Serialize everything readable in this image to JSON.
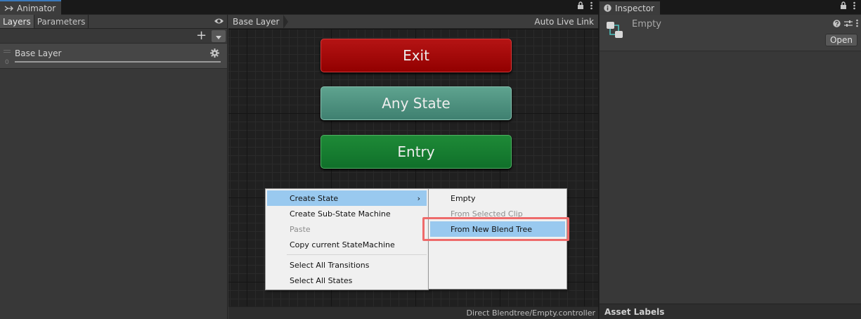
{
  "animator": {
    "tab_title": "Animator",
    "left_tabs": [
      "Layers",
      "Parameters"
    ],
    "add_label": "+",
    "layer": {
      "name": "Base Layer",
      "index": "0",
      "weight": 1
    },
    "breadcrumb": "Base Layer",
    "auto_live_link": "Auto Live Link",
    "states": {
      "exit": "Exit",
      "any": "Any State",
      "entry": "Entry"
    },
    "footer_path": "Direct Blendtree/Empty.controller"
  },
  "context_menu": {
    "items": [
      "Create State",
      "Create Sub-State Machine",
      "Paste",
      "Copy current StateMachine",
      "Select All Transitions",
      "Select All States"
    ],
    "submenu_arrow": "›",
    "submenu": [
      "Empty",
      "From Selected Clip",
      "From New Blend Tree"
    ]
  },
  "inspector": {
    "tab_title": "Inspector",
    "asset_name": "Empty",
    "open_label": "Open",
    "asset_labels": "Asset Labels"
  },
  "colors": {
    "exit_state": "#a30a0a",
    "any_state": "#4f927f",
    "entry_state": "#177d30",
    "menu_selection": "#99c9ef",
    "highlight_box": "#ee6b6b",
    "active_tab_accent": "#3a79bb"
  }
}
